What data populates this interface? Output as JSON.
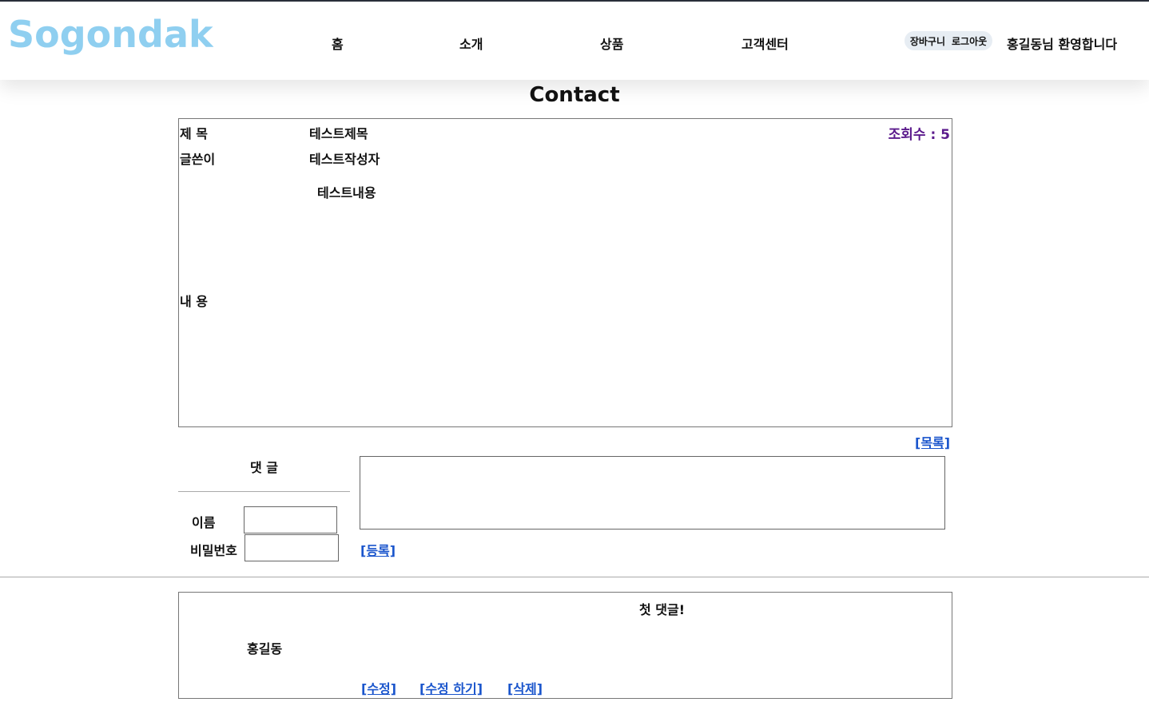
{
  "header": {
    "logo": "Sogondak",
    "nav": [
      "홈",
      "소개",
      "상품",
      "고객센터"
    ],
    "cart": "장바구니",
    "logout": "로그아웃",
    "welcome": "홍길동님 환영합니다"
  },
  "page": {
    "title": "Contact"
  },
  "post": {
    "subject_label": "제 목",
    "subject": "테스트제목",
    "author_label": "글쓴이",
    "author": "테스트작성자",
    "content_label": "내 용",
    "content": "테스트내용",
    "views_label": "조회수 : 5",
    "list_link": "[목록]"
  },
  "comment_form": {
    "label": "댓 글",
    "name_label": "이름",
    "name_value": "",
    "password_label": "비밀번호",
    "password_value": "",
    "comment_value": "",
    "register_link": "[등록]"
  },
  "comments": [
    {
      "author": "홍길동",
      "text": "첫 댓글!",
      "edit": "[수정]",
      "edit_do": "[수정 하기]",
      "delete": "[삭제]"
    }
  ]
}
